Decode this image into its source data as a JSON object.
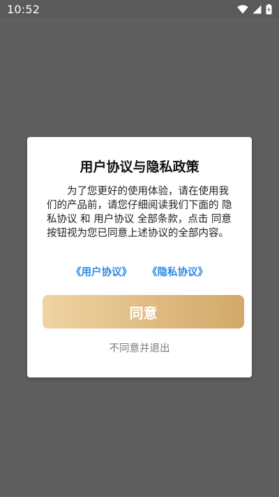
{
  "status_bar": {
    "time": "10:52",
    "icons": [
      "wifi-icon",
      "cell-signal-icon",
      "battery-charging-icon"
    ],
    "icon_color": "#ffffff"
  },
  "dialog": {
    "title": "用户协议与隐私政策",
    "body": "为了您更好的使用体验，请在使用我们的产品前，请您仔细阅读我们下面的 隐私协议 和 用户协议 全部条款，点击 同意 按钮视为您已同意上述协议的全部内容。",
    "links": {
      "user_agreement": "《用户协议》",
      "privacy_agreement": "《隐私协议》"
    },
    "agree_button": "同意",
    "decline_link": "不同意并退出"
  },
  "colors": {
    "overlay": "#5f5f5f",
    "link": "#2c8be6",
    "button_gradient_start": "#efd3a2",
    "button_gradient_end": "#d2a869",
    "decline_text": "#7a7a7a"
  }
}
